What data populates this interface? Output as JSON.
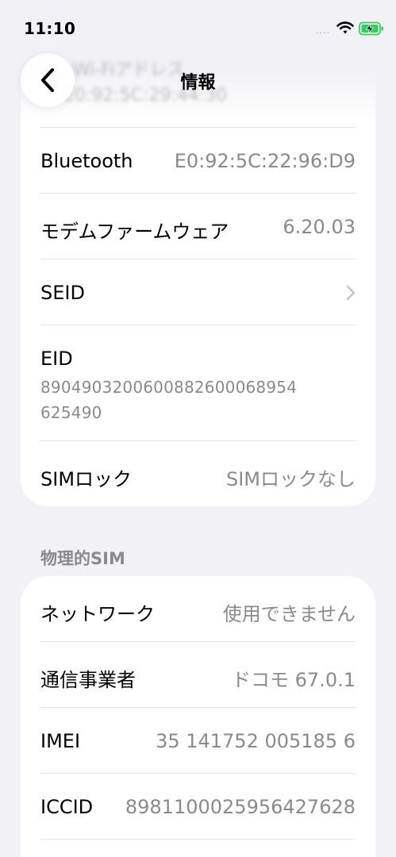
{
  "status_bar": {
    "time": "11:10",
    "signal": "....",
    "wifi_icon": "wifi-icon",
    "battery_icon": "battery-charging-icon",
    "battery_color": "#30d158"
  },
  "nav": {
    "title": "情報",
    "back_icon": "chevron-left-icon"
  },
  "ghost": {
    "label": "Wi-Fiアドレス",
    "value": "E0:92:5C:29:44:30"
  },
  "rows_top": [
    {
      "label": "Bluetooth",
      "value": "E0:92:5C:22:96:D9"
    },
    {
      "label": "モデムファームウェア",
      "value": "6.20.03"
    },
    {
      "label": "SEID",
      "value": ""
    },
    {
      "label": "EID",
      "value_line1": "8904903200600882600068954",
      "value_line2": "625490"
    },
    {
      "label": "SIMロック",
      "value": "SIMロックなし"
    }
  ],
  "section": {
    "header": "物理的SIM"
  },
  "rows_bottom": [
    {
      "label": "ネットワーク",
      "value": "使用できません"
    },
    {
      "label": "通信事業者",
      "value": "ドコモ 67.0.1"
    },
    {
      "label": "IMEI",
      "value": "35 141752 005185 6"
    },
    {
      "label": "ICCID",
      "value": "8981100025956427628"
    }
  ]
}
